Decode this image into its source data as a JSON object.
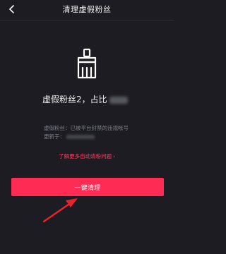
{
  "header": {
    "title": "清理虚假粉丝",
    "back_icon": "chevron-left-icon"
  },
  "main": {
    "icon": "broom-icon",
    "result_text": "虚假粉丝2，占比",
    "info_line1": "虚假粉丝：已被平台封禁的违规帐号",
    "info_line2_label": "更新于："
  },
  "link": {
    "label": "了解更多自动清粉问题",
    "chevron": "›"
  },
  "action": {
    "clean_button_label": "一键清理"
  },
  "annotation": {
    "arrow_icon": "pointer-arrow-icon"
  },
  "colors": {
    "background": "#1c1c22",
    "accent": "#fe2c55",
    "link": "#ff3f5e",
    "arrow": "#e8242b"
  }
}
